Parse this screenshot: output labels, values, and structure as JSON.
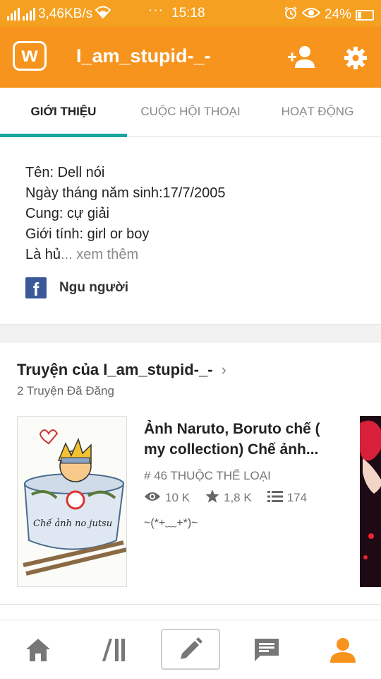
{
  "status_bar": {
    "network_speed": "3,46KB/s",
    "dots": "···",
    "time": "15:18",
    "battery": "24%"
  },
  "app_bar": {
    "logo_letter": "w",
    "username": "I_am_stupid-_-",
    "add_friend_icon": "add-user-icon",
    "settings_icon": "gear-icon",
    "brand_color": "#f7941d"
  },
  "tabs": [
    {
      "label": "GIỚI THIỆU",
      "active": true
    },
    {
      "label": "CUỘC HỘI THOẠI",
      "active": false
    },
    {
      "label": "HOẠT ĐỘNG",
      "active": false
    }
  ],
  "about": {
    "lines": [
      "Tên: Dell nói",
      "Ngày tháng năm sinh:17/7/2005",
      "Cung: cự giải",
      "Giới tính: girl or boy"
    ],
    "truncated_line": "Là hủ",
    "ellipsis": "...",
    "more_label": "xem thêm",
    "facebook_name": "Ngu người"
  },
  "stories": {
    "heading": "Truyện của I_am_stupid-_-",
    "count_label": "2 Truyện Đã Đăng",
    "items": [
      {
        "title": "Ảnh Naruto, Boruto chế ( my collection) Chế ảnh...",
        "cover_caption": "Chế ảnh no jutsu",
        "rank": "# 46 THUỘC THỂ LOẠI",
        "views": "10 K",
        "votes": "1,8 K",
        "parts": "174",
        "tagline": "~(*+﹏+*)~"
      }
    ]
  },
  "bottom_nav": [
    {
      "name": "home-icon"
    },
    {
      "name": "library-icon"
    },
    {
      "name": "pencil-icon"
    },
    {
      "name": "messages-icon"
    },
    {
      "name": "profile-icon",
      "active": true
    }
  ],
  "colors": {
    "accent_teal": "#19a5a0",
    "orange": "#f7941d",
    "facebook": "#3b5998"
  }
}
